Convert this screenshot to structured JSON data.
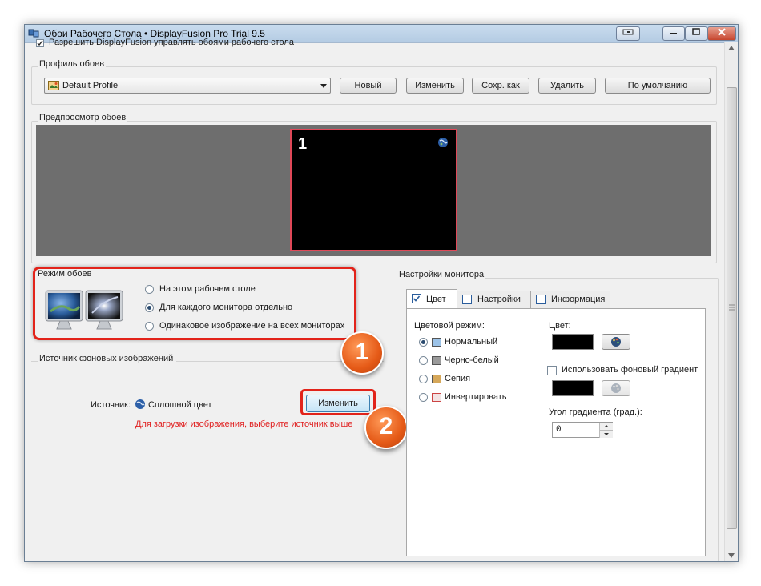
{
  "window": {
    "title": "Обои Рабочего Стола • DisplayFusion Pro Trial 9.5",
    "allow_checkbox_label": "Разрешить DisplayFusion управлять обоями рабочего стола"
  },
  "profile": {
    "group_label": "Профиль обоев",
    "selected": "Default Profile",
    "buttons": {
      "new": "Новый",
      "edit": "Изменить",
      "save_as": "Сохр. как",
      "delete": "Удалить",
      "default": "По умолчанию"
    }
  },
  "preview": {
    "group_label": "Предпросмотр обоев",
    "monitor_number": "1"
  },
  "mode": {
    "group_label": "Режим обоев",
    "options": [
      {
        "label": "На этом рабочем столе",
        "selected": false
      },
      {
        "label": "Для каждого монитора отдельно",
        "selected": true
      },
      {
        "label": "Одинаковое изображение на всех мониторах",
        "selected": false
      }
    ]
  },
  "source": {
    "group_label": "Источник фоновых изображений",
    "source_label": "Источник:",
    "source_value": "Сплошной цвет",
    "change_button": "Изменить",
    "hint": "Для загрузки изображения, выберите источник выше"
  },
  "monitor_settings": {
    "group_label": "Настройки монитора",
    "tabs": [
      "Цвет",
      "Настройки",
      "Информация"
    ],
    "color_mode_label": "Цветовой режим:",
    "color_modes": [
      {
        "label": "Нормальный",
        "selected": true
      },
      {
        "label": "Черно-белый",
        "selected": false
      },
      {
        "label": "Сепия",
        "selected": false
      },
      {
        "label": "Инвертировать",
        "selected": false
      }
    ],
    "color_label": "Цвет:",
    "gradient_checkbox": "Использовать фоновый градиент",
    "gradient_angle_label": "Угол градиента (град.):",
    "gradient_angle_value": "0",
    "color_value": "#000000",
    "gradient_color_value": "#000000"
  },
  "annotations": {
    "badge1": "1",
    "badge2": "2"
  },
  "colors": {
    "highlight": "#e2231a",
    "badge": "#e55a17",
    "hint_text": "#e02020",
    "preview_bg": "#6e6e6e"
  }
}
